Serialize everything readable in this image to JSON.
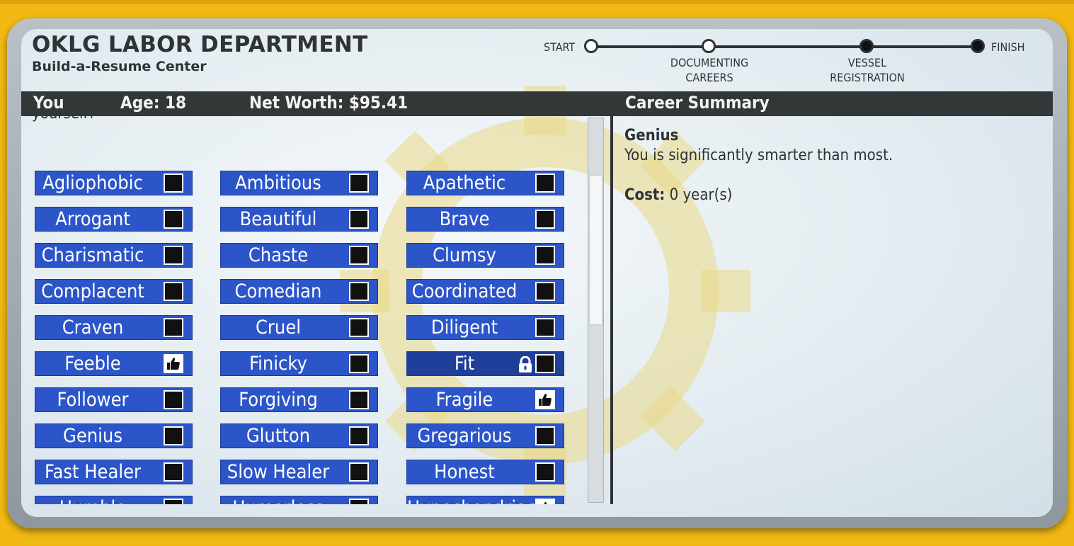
{
  "header": {
    "title": "OKLG LABOR DEPARTMENT",
    "subtitle": "Build-a-Resume Center"
  },
  "progress": {
    "start_label": "START",
    "finish_label": "FINISH",
    "steps": [
      {
        "line1": "DOCUMENTING",
        "line2": "CAREERS",
        "state": "open"
      },
      {
        "line1": "VESSEL",
        "line2": "REGISTRATION",
        "state": "filled"
      }
    ]
  },
  "status": {
    "you_label": "You",
    "age": "Age: 18",
    "net_worth": "Net Worth: $95.41",
    "summary_header": "Career Summary"
  },
  "question_fragment": "yourself?",
  "traits": [
    {
      "label": "Agliophobic",
      "state": "empty"
    },
    {
      "label": "Ambitious",
      "state": "empty"
    },
    {
      "label": "Apathetic",
      "state": "empty"
    },
    {
      "label": "Arrogant",
      "state": "empty"
    },
    {
      "label": "Beautiful",
      "state": "empty"
    },
    {
      "label": "Brave",
      "state": "empty"
    },
    {
      "label": "Charismatic",
      "state": "empty"
    },
    {
      "label": "Chaste",
      "state": "empty"
    },
    {
      "label": "Clumsy",
      "state": "empty"
    },
    {
      "label": "Complacent",
      "state": "empty"
    },
    {
      "label": "Comedian",
      "state": "empty"
    },
    {
      "label": "Coordinated",
      "state": "empty"
    },
    {
      "label": "Craven",
      "state": "empty"
    },
    {
      "label": "Cruel",
      "state": "empty"
    },
    {
      "label": "Diligent",
      "state": "empty"
    },
    {
      "label": "Feeble",
      "state": "checked"
    },
    {
      "label": "Finicky",
      "state": "empty"
    },
    {
      "label": "Fit",
      "state": "locked"
    },
    {
      "label": "Follower",
      "state": "empty"
    },
    {
      "label": "Forgiving",
      "state": "empty"
    },
    {
      "label": "Fragile",
      "state": "checked"
    },
    {
      "label": "Genius",
      "state": "empty"
    },
    {
      "label": "Glutton",
      "state": "empty"
    },
    {
      "label": "Gregarious",
      "state": "empty"
    },
    {
      "label": "Fast Healer",
      "state": "empty"
    },
    {
      "label": "Slow Healer",
      "state": "empty"
    },
    {
      "label": "Honest",
      "state": "empty"
    },
    {
      "label": "Humble",
      "state": "empty"
    },
    {
      "label": "Humorless",
      "state": "empty"
    },
    {
      "label": "Hypochondriac",
      "state": "checked"
    }
  ],
  "summary": {
    "name": "Genius",
    "description": "You is significantly smarter than most.",
    "cost_label": "Cost:",
    "cost_value": " 0 year(s)"
  },
  "colors": {
    "button_blue": "#2b55c8",
    "locked_blue": "#1f3f9a",
    "bar_dark": "#333738",
    "background_yellow": "#f2b915"
  },
  "icons": {
    "checked": "thumbs-up-icon",
    "locked": "padlock-icon"
  }
}
